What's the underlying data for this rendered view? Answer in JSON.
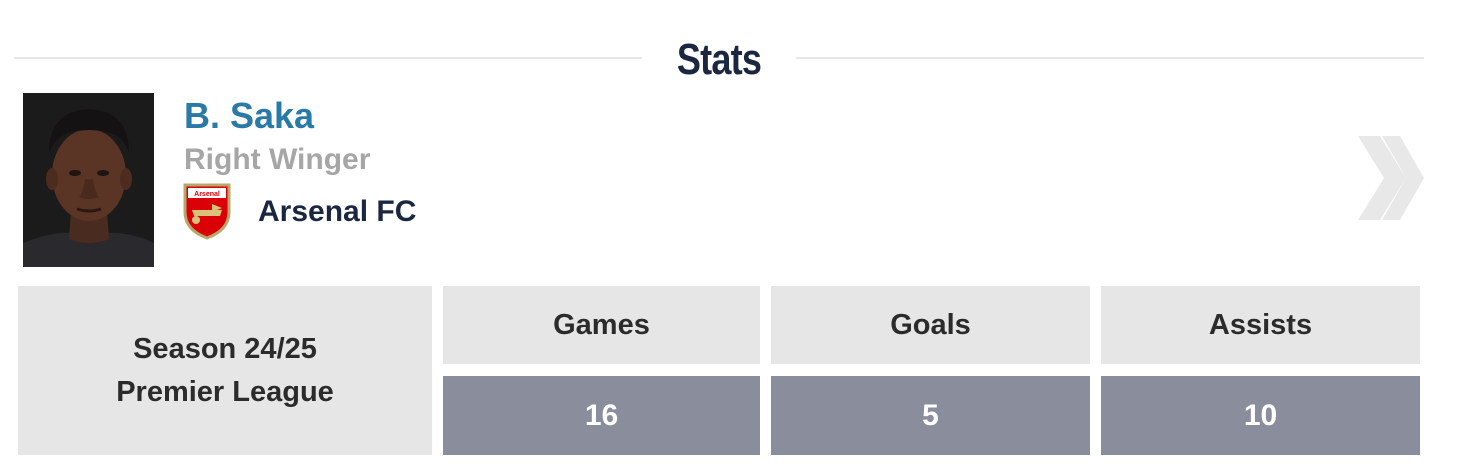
{
  "header": {
    "title": "Stats"
  },
  "player": {
    "name": "B. Saka",
    "position": "Right Winger",
    "club": "Arsenal FC",
    "crest_icon": "arsenal-crest-icon",
    "photo": "player-photo",
    "next_icon": "double-chevron-right-icon"
  },
  "stats": {
    "season_line1": "Season 24/25",
    "season_line2": "Premier League",
    "columns": [
      {
        "label": "Games",
        "value": "16"
      },
      {
        "label": "Goals",
        "value": "5"
      },
      {
        "label": "Assists",
        "value": "10"
      }
    ]
  },
  "colors": {
    "title": "#1b2740",
    "name": "#2a7aa8",
    "position": "#a6a6a6",
    "header_cell": "#e6e6e6",
    "value_cell": "#8a8e9c",
    "crest_red": "#db0007"
  }
}
